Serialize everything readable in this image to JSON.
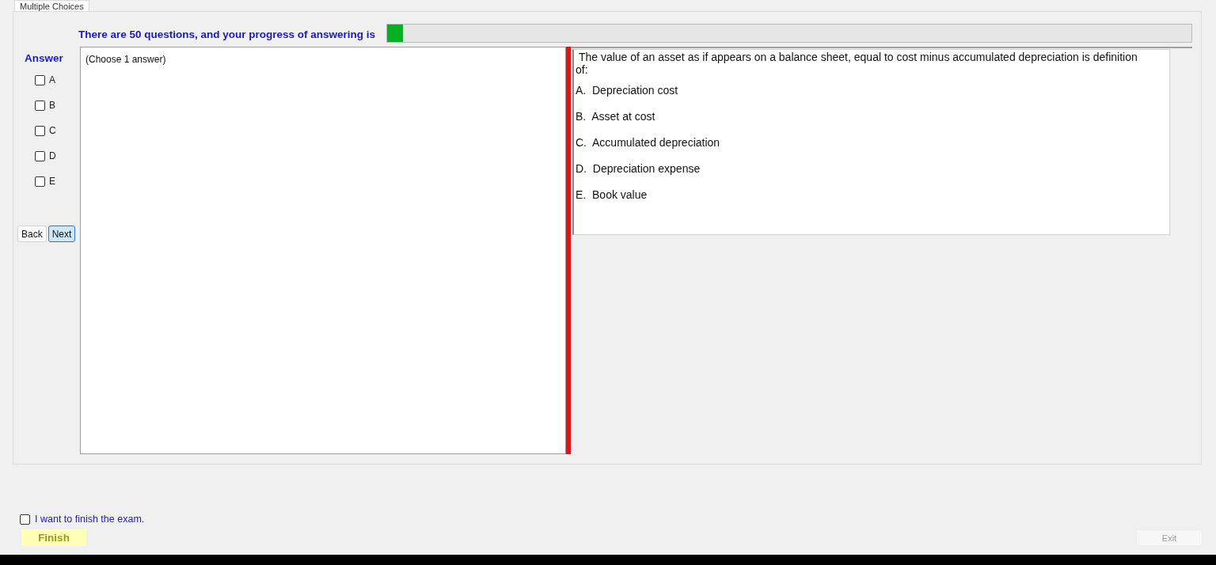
{
  "tabs": [
    {
      "label": "Multiple Choices",
      "selected": true
    }
  ],
  "progress": {
    "label": "There are 50 questions, and your progress of answering is",
    "level": 0.02
  },
  "answer": {
    "title": "Answer",
    "options": [
      {
        "label": "A",
        "checked": false
      },
      {
        "label": "B",
        "checked": false
      },
      {
        "label": "C",
        "checked": false
      },
      {
        "label": "D",
        "checked": false
      },
      {
        "label": "E",
        "checked": false
      }
    ]
  },
  "nav_buttons": [
    {
      "label": "Back",
      "selected": false
    },
    {
      "label": "Next",
      "selected": true
    }
  ],
  "answer_pane": {
    "text": "(Choose 1 answer)"
  },
  "question": {
    "text": " The value of an asset as if appears on a balance sheet, equal to cost minus accumulated depreciation is definition of:",
    "choices": [
      "A.  Depreciation cost",
      "B.  Asset at cost",
      "C.  Accumulated depreciation",
      "D.  Depreciation expense",
      "E.  Book value"
    ]
  },
  "finish": {
    "confirm_label": "I want to finish the exam.",
    "confirm_checked": false,
    "finish_button": "Finish",
    "exit_button": "Exit"
  }
}
